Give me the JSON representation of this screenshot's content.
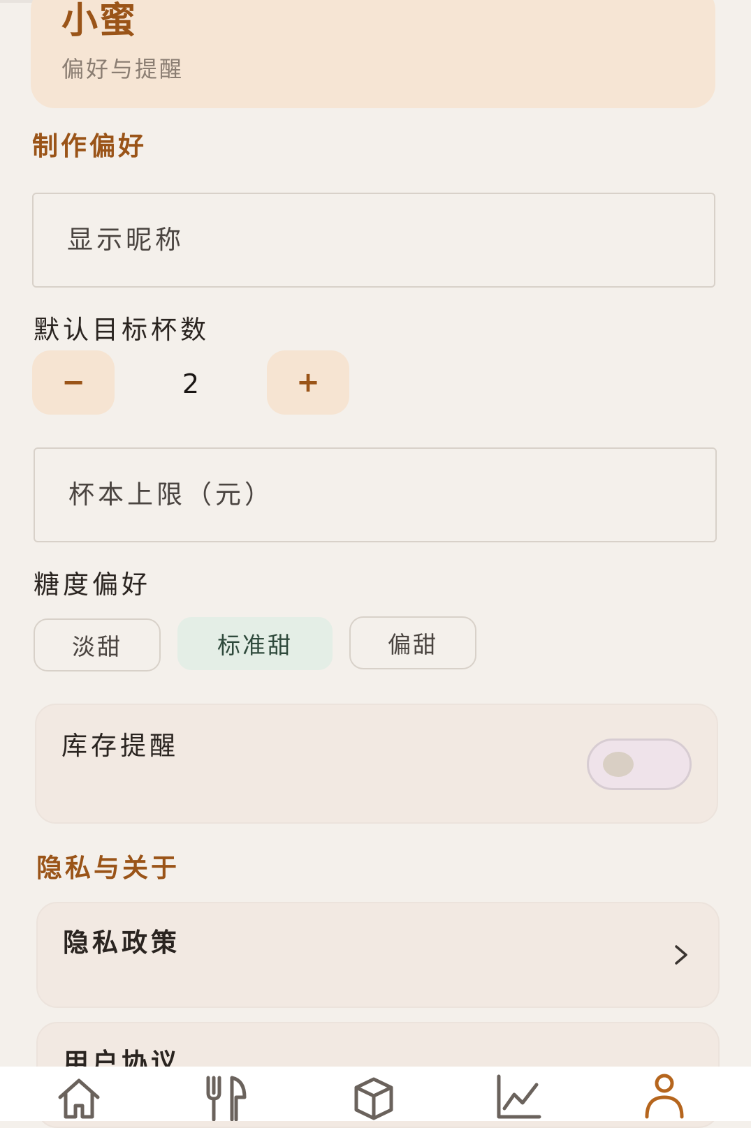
{
  "profile": {
    "name": "小蜜",
    "subtitle": "偏好与提醒"
  },
  "sections": {
    "preferences_title": "制作偏好",
    "privacy_title": "隐私与关于"
  },
  "fields": {
    "nickname_placeholder": "显示昵称",
    "cost_limit_placeholder": "杯本上限（元）"
  },
  "target_cups": {
    "label": "默认目标杯数",
    "decrement_label": "−",
    "value": "2",
    "increment_label": "+"
  },
  "sweetness": {
    "label": "糖度偏好",
    "options": [
      "淡甜",
      "标准甜",
      "偏甜"
    ],
    "selected": "标准甜"
  },
  "stock_reminder": {
    "label": "库存提醒",
    "enabled": false
  },
  "links": {
    "privacy_policy": "隐私政策",
    "user_agreement": "用户协议"
  },
  "nav": {
    "items": [
      "home-icon",
      "utensils-icon",
      "box-icon",
      "chart-icon",
      "user-icon"
    ],
    "active": "user-icon",
    "active_color": "#b5651d",
    "inactive_color": "#6a625c"
  },
  "colors": {
    "accent": "#9a5418",
    "background": "#f4f0eb",
    "selected_chip": "#e4eee6"
  }
}
